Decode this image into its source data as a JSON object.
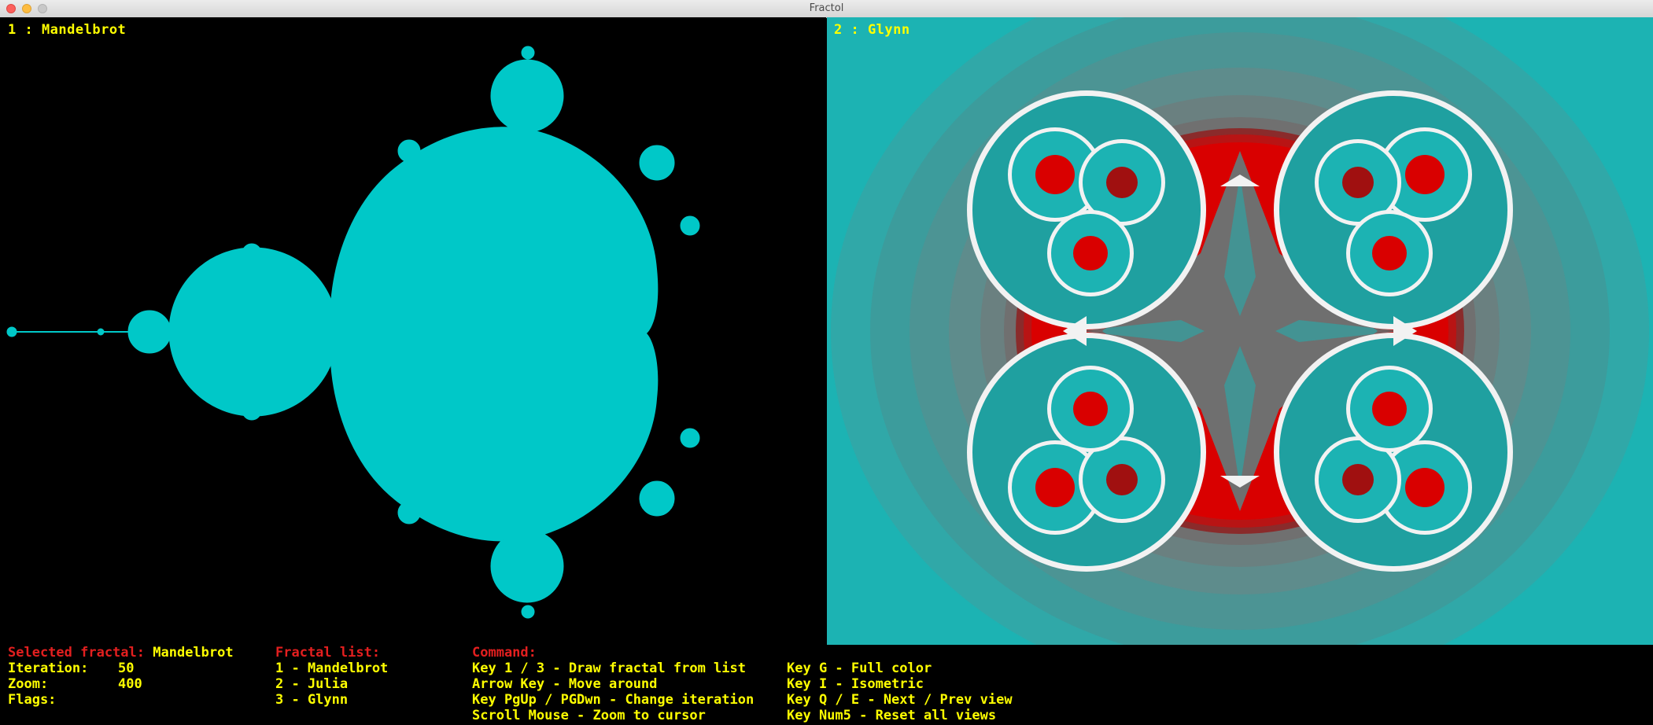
{
  "window": {
    "title": "Fractol"
  },
  "views": [
    {
      "label": "1 : Mandelbrot",
      "fractal": "Mandelbrot",
      "fill_color": "#00c8c8",
      "background": "#000000"
    },
    {
      "label": "2 : Glynn",
      "fractal": "Glynn",
      "palette": [
        "#1cb3b3",
        "#3c9c9c",
        "#5e8c8c",
        "#6f6f6f",
        "#a01010",
        "#d90000",
        "#f2f2f2"
      ]
    }
  ],
  "hud": {
    "selected_label": "Selected fractal:",
    "selected_value": "Mandelbrot",
    "iteration_label": "Iteration:",
    "iteration_value": "50",
    "zoom_label": "Zoom:",
    "zoom_value": "400",
    "flags_label": "Flags:",
    "fractal_list_title": "Fractal list:",
    "fractal_list": [
      "1 - Mandelbrot",
      "2 - Julia",
      "3 - Glynn"
    ],
    "command_title": "Command:",
    "commands": [
      "Key 1 / 3 - Draw fractal from list",
      "Arrow Key - Move around",
      "Key PgUp / PGDwn - Change iteration",
      "Scroll Mouse - Zoom to cursor"
    ],
    "keys": [
      "Key G - Full color",
      "Key I - Isometric",
      "Key Q / E - Next / Prev view",
      "Key Num5 - Reset all views"
    ]
  },
  "colors": {
    "hud_heading": "#e31f1f",
    "hud_text": "#ffff00",
    "mandelbrot": "#00c8c8"
  }
}
